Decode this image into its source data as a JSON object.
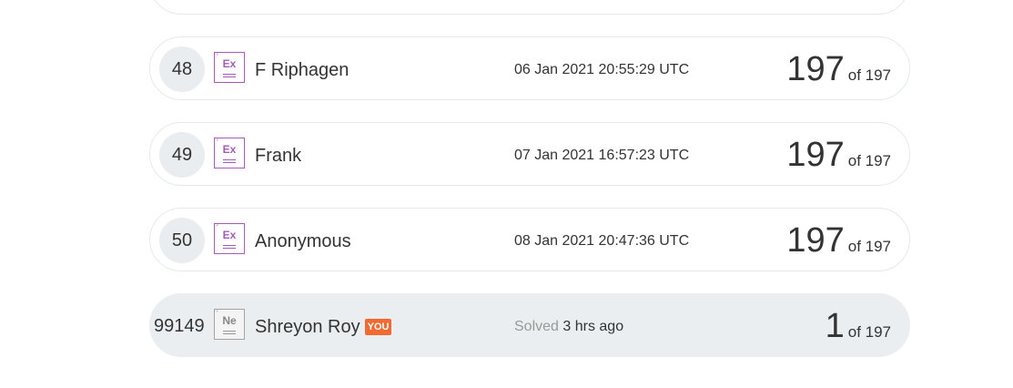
{
  "leaderboard": {
    "rows": [
      {
        "rank": "48",
        "level_symbol": "Ex",
        "name": "F Riphagen",
        "timestamp": "06 Jan 2021 20:55:29 UTC",
        "score": "197",
        "of_text": "of 197"
      },
      {
        "rank": "49",
        "level_symbol": "Ex",
        "name": "Frank",
        "timestamp": "07 Jan 2021 16:57:23 UTC",
        "score": "197",
        "of_text": "of 197"
      },
      {
        "rank": "50",
        "level_symbol": "Ex",
        "name": "Anonymous",
        "timestamp": "08 Jan 2021 20:47:36 UTC",
        "score": "197",
        "of_text": "of 197"
      }
    ],
    "current_user": {
      "rank": "99149",
      "level_symbol": "Ne",
      "name": "Shreyon Roy",
      "badge": "YOU",
      "solved_label": "Solved",
      "solved_ago": "3 hrs ago",
      "score": "1",
      "of_text": "of 197"
    },
    "colors": {
      "row_border": "#e6e9ec",
      "rank_bg": "#e9edf0",
      "current_user_bg": "#eaeef1",
      "level_ex": "#a45dbb",
      "level_ne": "#a3a3a3",
      "you_badge": "#f06a32"
    },
    "level_tick_mark": "'"
  }
}
